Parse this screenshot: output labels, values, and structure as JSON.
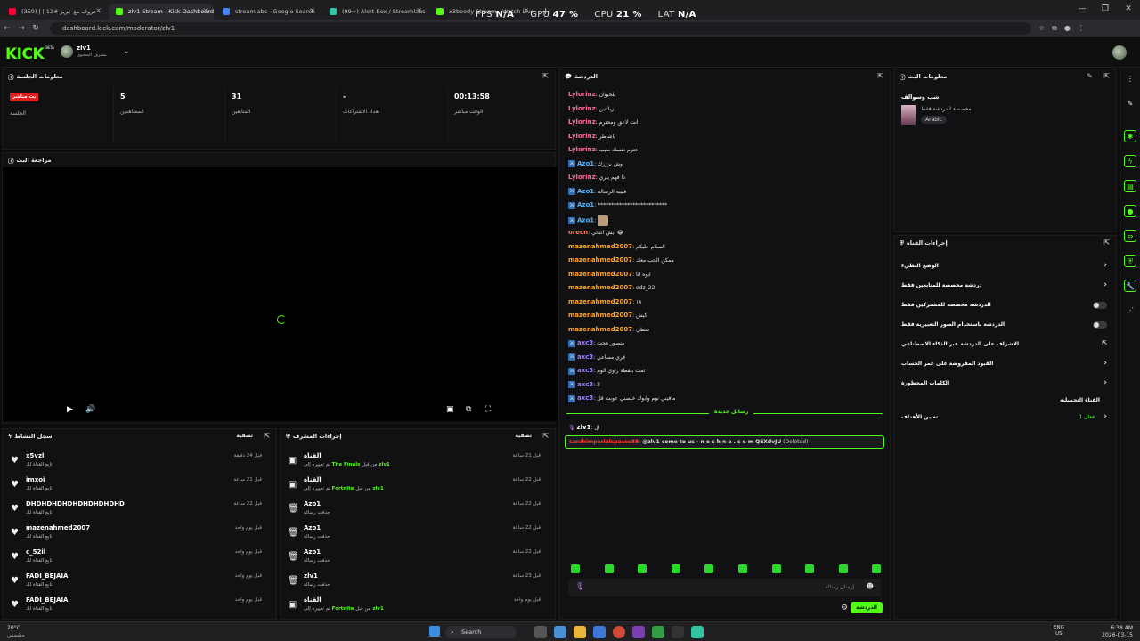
{
  "browser": {
    "tabs": [
      {
        "title": "(359) حروف مع عزيز #12 | إ",
        "favicon_color": "#ff0033",
        "active": false
      },
      {
        "title": "zlv1 Stream - Kick Dashboard",
        "favicon_color": "#53fc18",
        "active": true
      },
      {
        "title": "streamlabs - Google Search",
        "favicon_color": "#4285f4",
        "active": false
      },
      {
        "title": "(99+) Alert Box / Streamlabs",
        "favicon_color": "#31c3a2",
        "active": false
      },
      {
        "title": "x3boody Stream - Watch Live",
        "favicon_color": "#53fc18",
        "active": false
      }
    ],
    "new_tab": "+",
    "url": "dashboard.kick.com/moderator/zlv1"
  },
  "overlay": {
    "fps_label": "FPS",
    "fps_value": "N/A",
    "gpu_label": "GPU",
    "gpu_value": "47 %",
    "cpu_label": "CPU",
    "cpu_value": "21 %",
    "lat_label": "LAT",
    "lat_value": "N/A"
  },
  "header": {
    "logo": "KICK",
    "logo_beta": "BETA",
    "channel_name": "zlv1",
    "channel_sub": "مشرف المحتوى"
  },
  "session": {
    "title": "معلومات الجلسة",
    "live_badge": "بث مباشر",
    "session_label": "الجلسة",
    "stats": [
      {
        "value": "5",
        "label": "المشاهدين"
      },
      {
        "value": "31",
        "label": "المتابعين"
      },
      {
        "value": "-",
        "label": "تعداد الاشتراكات"
      },
      {
        "value": "00:13:58",
        "label": "الوقت مباشر"
      }
    ]
  },
  "preview": {
    "title": "مراجعة البث"
  },
  "activity": {
    "title": "سجل النشاط",
    "filter": "تصفية",
    "items": [
      {
        "name": "x5vzl",
        "sub": "تابع القناة لك",
        "time": "قبل 24 دقيقة"
      },
      {
        "name": "imxoi",
        "sub": "تابع القناة لك",
        "time": "قبل 21 ساعة"
      },
      {
        "name": "DHDHDHDHDHDHDHDHDHD",
        "sub": "تابع القناة لك",
        "time": "قبل 22 ساعة"
      },
      {
        "name": "mazenahmed2007",
        "sub": "تابع القناة لك",
        "time": "قبل يوم واحد"
      },
      {
        "name": "c_52il",
        "sub": "تابع القناة لك",
        "time": "قبل يوم واحد"
      },
      {
        "name": "FADI_BEJAIA",
        "sub": "تابع القناة لك",
        "time": "قبل يوم واحد"
      },
      {
        "name": "FADI_BEJAIA",
        "sub": "تابع القناة لك",
        "time": "قبل يوم واحد"
      }
    ]
  },
  "mod_actions": {
    "title": "إجراءات المشرف",
    "filter": "تصفية",
    "items": [
      {
        "name": "القناة",
        "sub_a": "تم تغييره إلى ",
        "game": "The Finals",
        "sub_b": " من قبل ",
        "by": "zlv1",
        "time": "قبل 21 ساعة"
      },
      {
        "name": "القناة",
        "sub_a": "تم تغييره إلى ",
        "game": "Fortnite",
        "sub_b": " من قبل ",
        "by": "zlv1",
        "time": "قبل 22 ساعة"
      },
      {
        "name": "Azo1",
        "sub_a": "حذفت رسالة",
        "game": "",
        "sub_b": "",
        "by": "",
        "time": "قبل 22 ساعة"
      },
      {
        "name": "Azo1",
        "sub_a": "حذفت رسالة",
        "game": "",
        "sub_b": "",
        "by": "",
        "time": "قبل 22 ساعة"
      },
      {
        "name": "Azo1",
        "sub_a": "حذفت رسالة",
        "game": "",
        "sub_b": "",
        "by": "",
        "time": "قبل 22 ساعة"
      },
      {
        "name": "zlv1",
        "sub_a": "حذفت رسالة",
        "game": "",
        "sub_b": "",
        "by": "",
        "time": "قبل 23 ساعة"
      },
      {
        "name": "القناة",
        "sub_a": "تم تغييره إلى ",
        "game": "Fortnite",
        "sub_b": " من قبل ",
        "by": "zlv1",
        "time": "قبل يوم واحد"
      }
    ]
  },
  "chat": {
    "title": "الدردشة",
    "messages": [
      {
        "user": "Lylorinz",
        "color": "#ff6b9a",
        "text": "يلحيوان",
        "mod": false
      },
      {
        "user": "Lylorinz",
        "color": "#ff6b9a",
        "text": "زبالتين",
        "mod": false
      },
      {
        "user": "Lylorinz",
        "color": "#ff6b9a",
        "text": "انت لاعق ومحترم",
        "mod": false
      },
      {
        "user": "Lylorinz",
        "color": "#ff6b9a",
        "text": "ياشاطر",
        "mod": false
      },
      {
        "user": "Lylorinz",
        "color": "#ff6b9a",
        "text": "احترم نفسك طيب",
        "mod": false
      },
      {
        "user": "Azo1",
        "color": "#4fb3ff",
        "text": "وش يزززك",
        "mod": true
      },
      {
        "user": "Lylorinz",
        "color": "#ff6b9a",
        "text": "ذا فهم يبري",
        "mod": false
      },
      {
        "user": "Azo1",
        "color": "#4fb3ff",
        "text": "فتيبه الرساله",
        "mod": true
      },
      {
        "user": "Azo1",
        "color": "#4fb3ff",
        "text": "**************************",
        "mod": true
      },
      {
        "user": "Azo1",
        "color": "#4fb3ff",
        "text": "",
        "mod": true
      },
      {
        "user": "orecn",
        "color": "#ff7a59",
        "text": "ايش انتحي 😂",
        "mod": false
      },
      {
        "user": "mazenahmed2007",
        "color": "#ffa42b",
        "text": "السلام عليكم",
        "mod": false
      },
      {
        "user": "mazenahmed2007",
        "color": "#ffa42b",
        "text": "ممكن الحب معك",
        "mod": false
      },
      {
        "user": "mazenahmed2007",
        "color": "#ffa42b",
        "text": "ايوه انا",
        "mod": false
      },
      {
        "user": "mazenahmed2007",
        "color": "#ffa42b",
        "text": "odz_22",
        "mod": false
      },
      {
        "user": "mazenahmed2007",
        "color": "#ffa42b",
        "text": "١٨",
        "mod": false
      },
      {
        "user": "mazenahmed2007",
        "color": "#ffa42b",
        "text": "كيش",
        "mod": false
      },
      {
        "user": "mazenahmed2007",
        "color": "#ffa42b",
        "text": "سطي",
        "mod": false
      },
      {
        "user": "axc3",
        "color": "#9b7bff",
        "text": "منصور هجت",
        "mod": true
      },
      {
        "user": "axc3",
        "color": "#9b7bff",
        "text": "قري مساعي",
        "mod": true
      },
      {
        "user": "axc3",
        "color": "#9b7bff",
        "text": "تمت بلقطة راوي الوم",
        "mod": true
      },
      {
        "user": "axc3",
        "color": "#9b7bff",
        "text": "2",
        "mod": true
      },
      {
        "user": "axc3",
        "color": "#9b7bff",
        "text": "مافيني نوم وابوك خلصني عوبت قل",
        "mod": true
      }
    ],
    "new_messages_label": "رسائل جديدة",
    "pinned_user": "zlv1",
    "pinned_text": "ال",
    "deleted_user": "sarahimperialspaces88",
    "deleted_text": "@zlv1 come to us - n e c h n e . c o m QEXdvJU",
    "deleted_tag": "(Deleted)",
    "input_placeholder": "إرسال رسالة",
    "send_button": "الدردشة"
  },
  "stream_info": {
    "title": "معلومات البث",
    "stream_title": "شب وسوالف",
    "category": "مخصصة الدردشة فقط",
    "language": "Arabic"
  },
  "channel_actions": {
    "title": "إجراءات القناة",
    "items": [
      {
        "label": "الوضع البطيء",
        "type": "arrow"
      },
      {
        "label": "دردشة مخصصة للمتابعين فقط",
        "type": "arrow"
      },
      {
        "label": "الدردشة مخصصة للمشتركين فقط",
        "type": "toggle"
      },
      {
        "label": "الدردشة باستخدام الصور التعبيرية فقط",
        "type": "toggle"
      },
      {
        "label": "الإشراف على الدردشة عبر الذكاء الاصطناعي",
        "type": "external"
      },
      {
        "label": "القيود المفروضة على عمر الحساب",
        "type": "arrow"
      },
      {
        "label": "الكلمات المحظورة",
        "type": "arrow"
      }
    ],
    "loaded_label": "القناة التحميلية",
    "target_label": "تعيين الأهداف",
    "target_status": "فعال 1"
  },
  "taskbar": {
    "search": "Search",
    "weather_temp": "20°C",
    "weather_desc": "مشمس",
    "lang_top": "ENG",
    "lang_bottom": "US",
    "time": "6:38 AM",
    "date": "2026-03-15"
  },
  "colors": {
    "accent": "#53fc18",
    "live": "#e11d1d",
    "mod_badge": "#2e6fb5"
  }
}
